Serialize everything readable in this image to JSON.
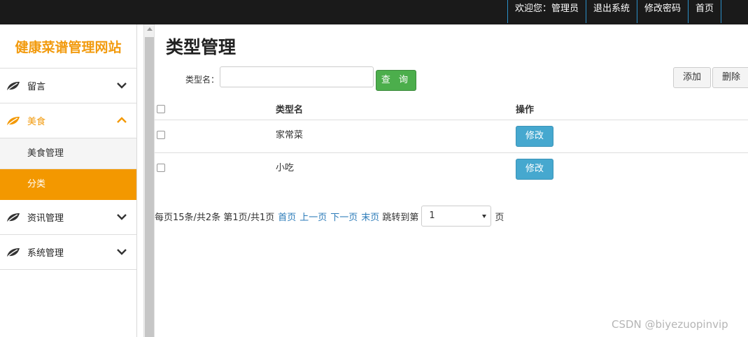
{
  "topnav": {
    "welcome": "欢迎您：管理员",
    "logout": "退出系统",
    "change_password": "修改密码",
    "home": "首页"
  },
  "sidebar": {
    "brand": "健康菜谱管理网站",
    "items": [
      {
        "label": "留言"
      },
      {
        "label": "美食",
        "expanded": true
      },
      {
        "label": "资讯管理"
      },
      {
        "label": "系统管理"
      }
    ],
    "sub_items": [
      {
        "label": "美食管理"
      },
      {
        "label": "分类"
      }
    ]
  },
  "main": {
    "title": "类型管理",
    "search": {
      "label": "类型名：",
      "value": "",
      "placeholder": ""
    },
    "query_button": "查 询",
    "add_button": "添加",
    "delete_button": "删除"
  },
  "table": {
    "headers": {
      "name": "类型名",
      "ops": "操作"
    },
    "rows": [
      {
        "name": "家常菜",
        "edit": "修改"
      },
      {
        "name": "小吃",
        "edit": "修改"
      }
    ]
  },
  "pager": {
    "summary": "每页15条/共2条 第1页/共1页",
    "first": "首页",
    "prev": "上一页",
    "next": "下一页",
    "last": "末页",
    "jump_label": "跳转到第",
    "selected_page": "1",
    "suffix": "页"
  },
  "watermark": "CSDN @biyezuopinvip",
  "colors": {
    "accent": "#f39800",
    "query": "#4cae4c",
    "edit": "#46a8cf",
    "link": "#2a7ab8"
  }
}
